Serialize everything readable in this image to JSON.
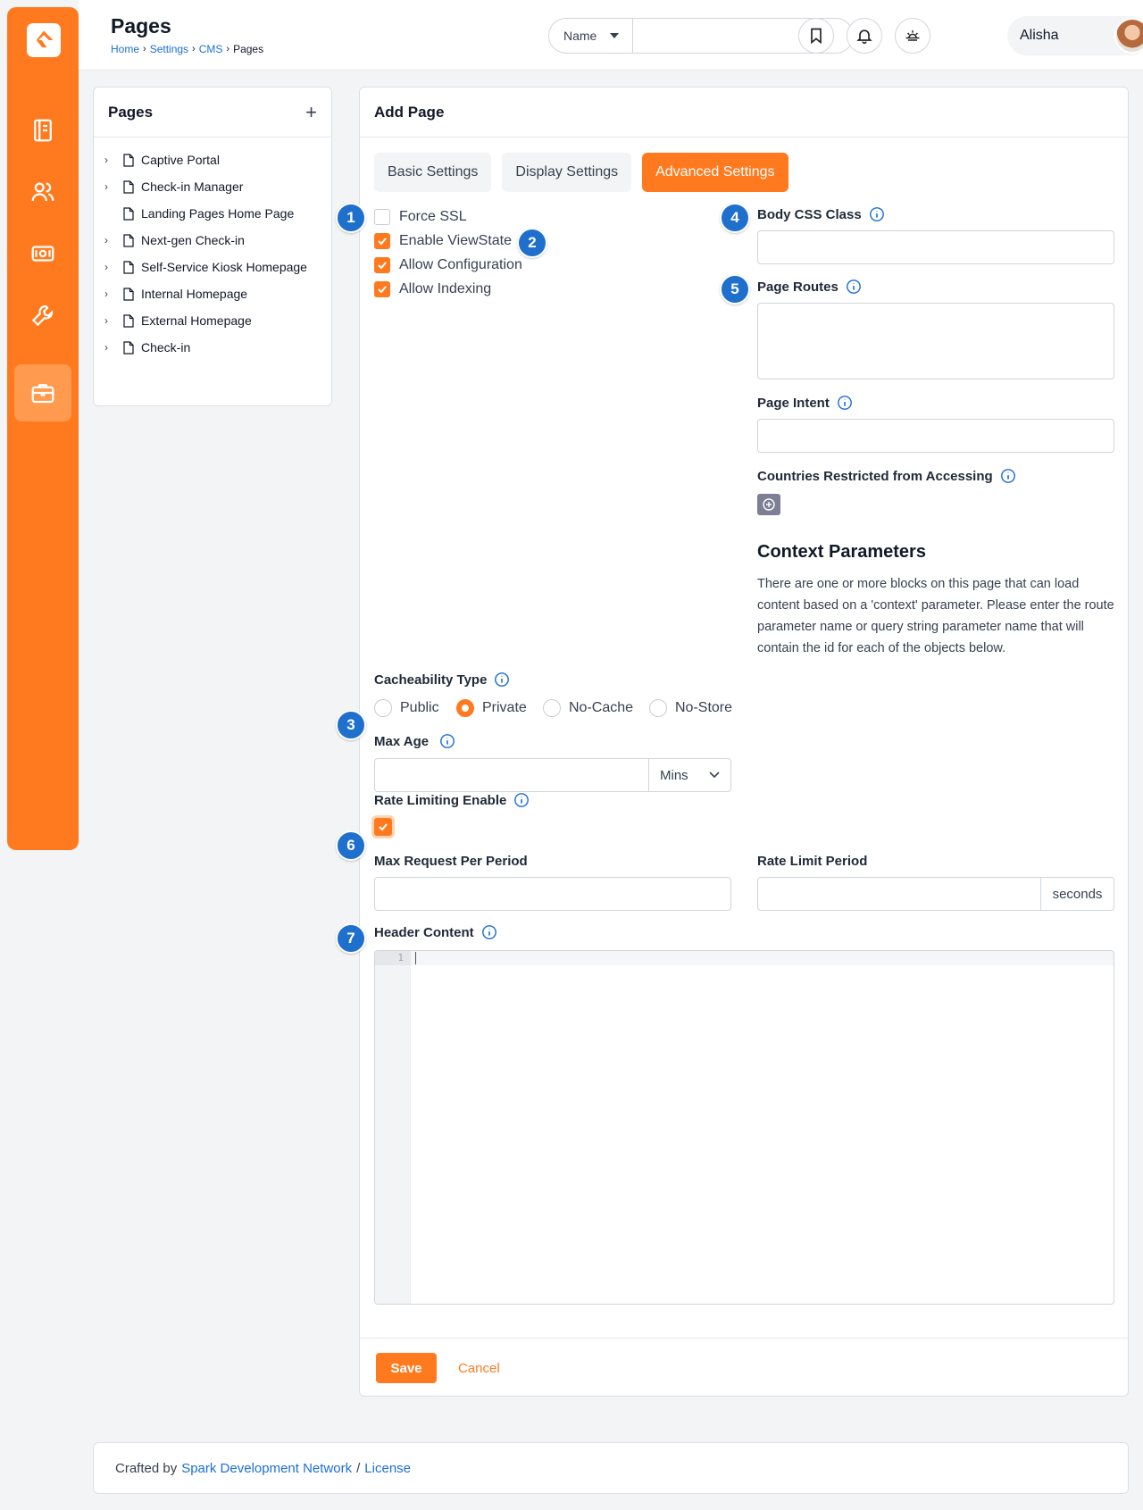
{
  "header": {
    "title": "Pages",
    "breadcrumb": [
      "Home",
      "Settings",
      "CMS",
      "Pages"
    ],
    "search_select": "Name",
    "search_placeholder": "",
    "user_name": "Alisha"
  },
  "colors": {
    "accent": "#ff7a1f",
    "link": "#1d6fd6",
    "badge": "#1f6fcd"
  },
  "sidebar": {
    "icons": [
      "book-icon",
      "people-icon",
      "finance-icon",
      "wrench-icon",
      "briefcase-icon"
    ],
    "active": "briefcase-icon"
  },
  "tree_panel": {
    "title": "Pages",
    "add_symbol": "+",
    "items": [
      {
        "label": "Captive Portal",
        "expandable": true
      },
      {
        "label": "Check-in Manager",
        "expandable": true
      },
      {
        "label": "Landing Pages Home Page",
        "expandable": false
      },
      {
        "label": "Next-gen Check-in",
        "expandable": true
      },
      {
        "label": "Self-Service Kiosk Homepage",
        "expandable": true
      },
      {
        "label": "Internal Homepage",
        "expandable": true
      },
      {
        "label": "External Homepage",
        "expandable": true
      },
      {
        "label": "Check-in",
        "expandable": true
      }
    ]
  },
  "main": {
    "title": "Add Page",
    "tabs": [
      {
        "label": "Basic Settings",
        "active": false
      },
      {
        "label": "Display Settings",
        "active": false
      },
      {
        "label": "Advanced Settings",
        "active": true
      }
    ],
    "checkboxes": [
      {
        "label": "Force SSL",
        "checked": false
      },
      {
        "label": "Enable ViewState",
        "checked": true
      },
      {
        "label": "Allow Configuration",
        "checked": true
      },
      {
        "label": "Allow Indexing",
        "checked": true
      }
    ],
    "body_css_class_label": "Body CSS Class",
    "page_routes_label": "Page Routes",
    "page_intent_label": "Page Intent",
    "countries_label": "Countries Restricted from Accessing",
    "context_title": "Context Parameters",
    "context_text": "There are one or more blocks on this page that can load content based on a 'context' parameter. Please enter the route parameter name or query string parameter name that will contain the id for each of the objects below.",
    "cacheability_label": "Cacheability Type",
    "cacheability_options": [
      {
        "label": "Public",
        "checked": false
      },
      {
        "label": "Private",
        "checked": true
      },
      {
        "label": "No-Cache",
        "checked": false
      },
      {
        "label": "No-Store",
        "checked": false
      }
    ],
    "max_age_label": "Max Age",
    "max_age_unit": "Mins",
    "rate_limiting_label": "Rate Limiting Enable",
    "rate_limiting_checked": true,
    "max_request_label": "Max Request Per Period",
    "rate_limit_period_label": "Rate Limit Period",
    "rate_limit_unit": "seconds",
    "header_content_label": "Header Content",
    "editor_line": "1",
    "save_label": "Save",
    "cancel_label": "Cancel"
  },
  "badges": [
    "1",
    "2",
    "3",
    "4",
    "5",
    "6",
    "7"
  ],
  "footer": {
    "prefix": "Crafted by",
    "link1": "Spark Development Network",
    "sep": "/",
    "link2": "License"
  }
}
